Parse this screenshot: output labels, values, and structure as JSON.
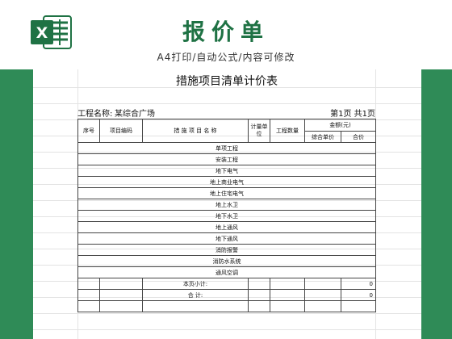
{
  "banner": {
    "title": "报价单",
    "subtitle": "A4打印/自动公式/内容可修改",
    "logo_icon": "excel-logo-icon",
    "logo_letter": "X",
    "brand_color": "#1f7244",
    "background_color": "#2f8b57"
  },
  "sheet": {
    "title": "措施项目清单计价表",
    "project_label": "工程名称:",
    "project_name": "某综合广场",
    "page_info": "第1页  共1页",
    "headers": {
      "seq": "序号",
      "code": "项目编码",
      "name": "措 施 项 目 名 称",
      "unit": "计量单位",
      "quantity": "工程数量",
      "amount": "金额(元)",
      "unit_price": "综合单价",
      "total": "合价"
    },
    "rows": [
      "单项工程",
      "安装工程",
      "地下电气",
      "地上商业电气",
      "地上住宅电气",
      "地上水卫",
      "地下水卫",
      "地上通风",
      "地下通风",
      "消防报警",
      "消防水系统",
      "通风空调"
    ],
    "subtotal_label": "本页小计:",
    "subtotal_value": "0",
    "total_label": "合      计:",
    "total_value": "0"
  }
}
